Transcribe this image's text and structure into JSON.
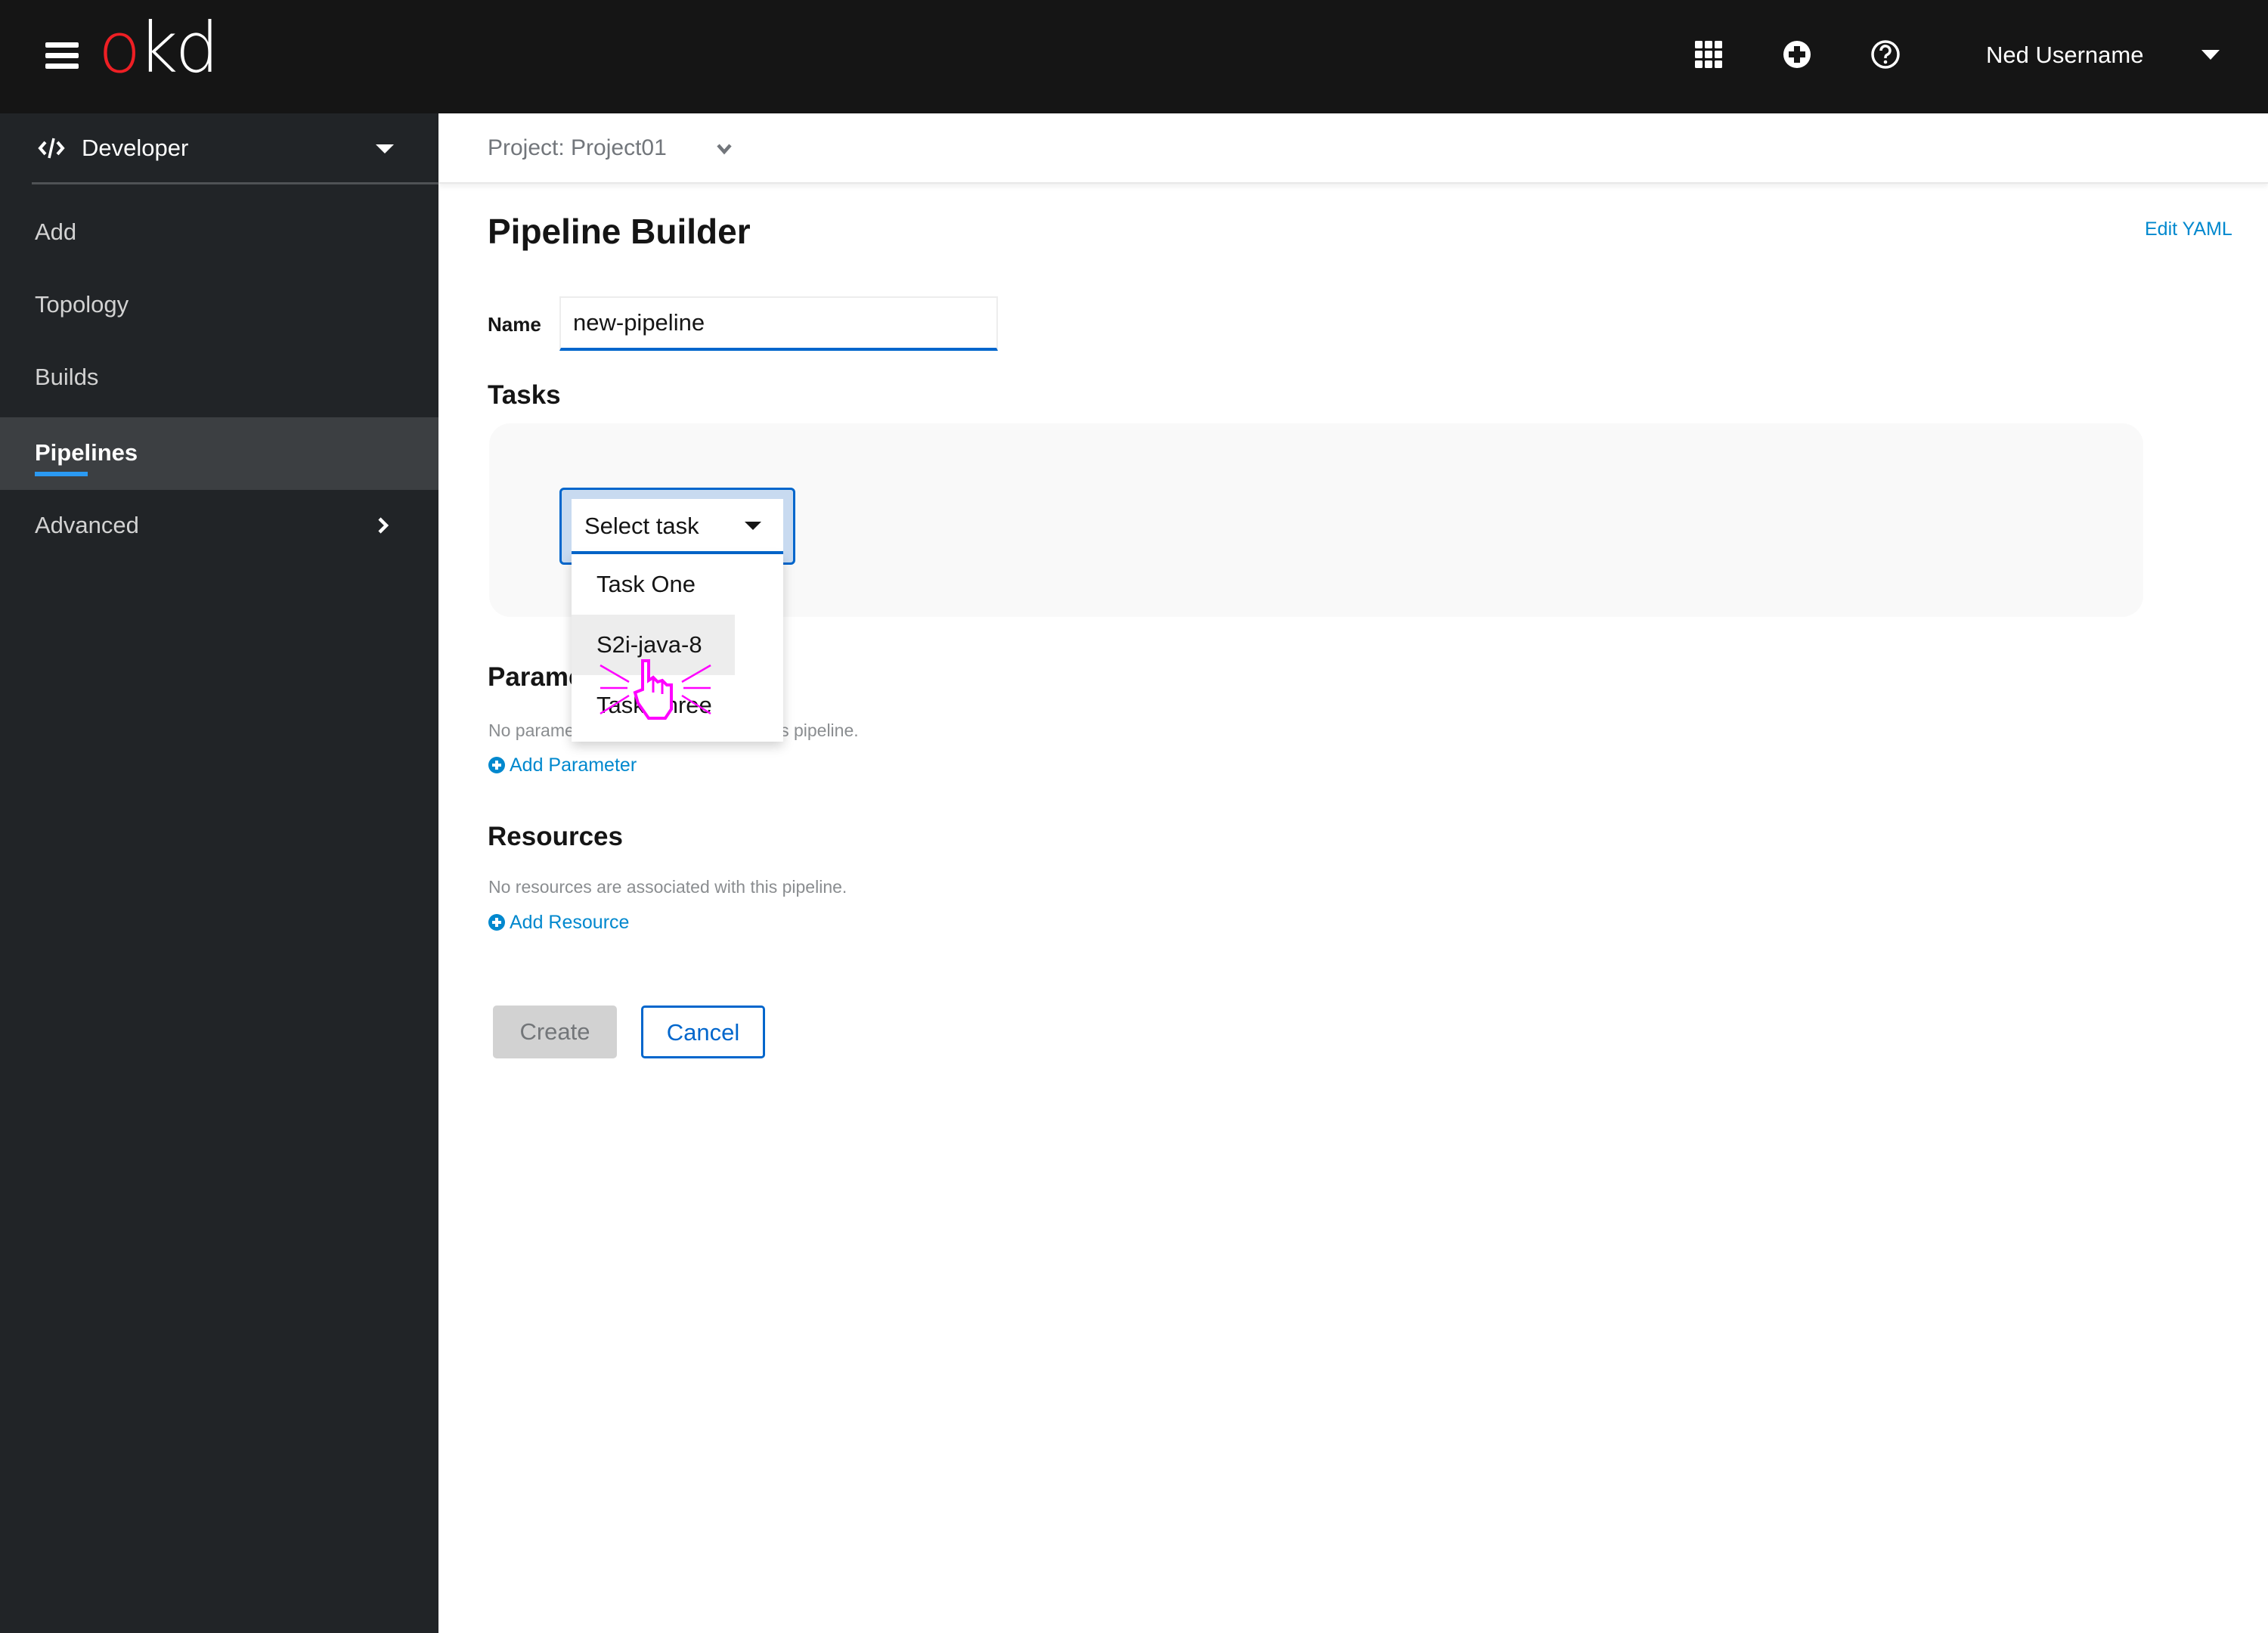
{
  "masthead": {
    "logo": {
      "o": "o",
      "kd": "kd"
    },
    "icons": [
      "app-launcher-icon",
      "plus-circle-icon",
      "help-icon"
    ],
    "user_name": "Ned Username"
  },
  "sidebar": {
    "perspective": "Developer",
    "items": [
      {
        "label": "Add",
        "active": false
      },
      {
        "label": "Topology",
        "active": false
      },
      {
        "label": "Builds",
        "active": false
      },
      {
        "label": "Pipelines",
        "active": true
      },
      {
        "label": "Advanced",
        "active": false,
        "expandable": true
      }
    ]
  },
  "project_bar": {
    "label": "Project:  Project01"
  },
  "page": {
    "title": "Pipeline Builder",
    "edit_yaml": "Edit YAML",
    "name_label": "Name",
    "name_value": "new-pipeline",
    "tasks_title": "Tasks",
    "select_task": {
      "placeholder": "Select task",
      "options": [
        "Task One",
        "S2i-java-8",
        "Task Three"
      ],
      "hovered": "S2i-java-8"
    },
    "parameters_title": "Parameters",
    "parameters_empty": "No parameters are associated with this pipeline.",
    "add_parameter": "Add Parameter",
    "resources_title": "Resources",
    "resources_empty": "No resources are associated with this pipeline.",
    "add_resource": "Add Resource",
    "create_button": "Create",
    "cancel_button": "Cancel"
  },
  "colors": {
    "masthead_bg": "#151515",
    "sidebar_bg": "#212427",
    "sidebar_active_bg": "#3c3f42",
    "active_indicator": "#2b9af3",
    "logo_accent": "#ee1f24",
    "primary_blue": "#0066cc",
    "link_blue": "#0088ce",
    "cursor_highlight": "#ff00ff"
  }
}
